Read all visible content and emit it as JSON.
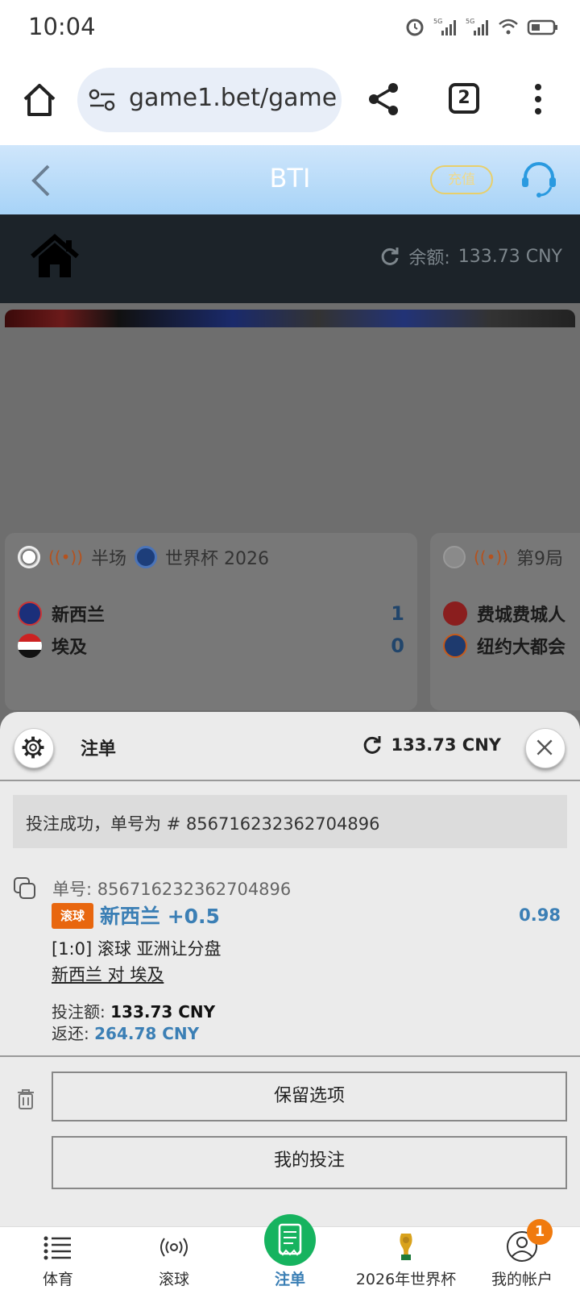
{
  "status_bar": {
    "time": "10:04"
  },
  "browser": {
    "url": "game1.bet/game",
    "tab_count": "2"
  },
  "site_header": {
    "title": "BTI",
    "deposit_label": "充值"
  },
  "balance_bar": {
    "label": "余额:",
    "amount": "133.73 CNY"
  },
  "match_cards": [
    {
      "period": "半场",
      "competition": "世界杯 2026",
      "home_team": "新西兰",
      "away_team": "埃及",
      "home_score": "1",
      "away_score": "0"
    },
    {
      "period": "第9局",
      "home_team": "费城费城人",
      "away_team": "纽约大都会"
    }
  ],
  "bet_slip": {
    "title": "注单",
    "balance": "133.73 CNY",
    "success_message": "投注成功，单号为 # 856716232362704896",
    "ticket_label": "单号:",
    "ticket_number": "856716232362704896",
    "live_badge": "滚球",
    "selection": "新西兰 +0.5",
    "odds": "0.98",
    "market": "[1:0] 滚球 亚洲让分盘",
    "fixture": "新西兰 对 埃及",
    "stake_label": "投注额:",
    "stake": "133.73 CNY",
    "return_label": "返还:",
    "return": "264.78 CNY",
    "keep_selection_label": "保留选项",
    "my_bets_label": "我的投注"
  },
  "bottom_nav": {
    "items": [
      {
        "label": "体育",
        "icon": "list-icon"
      },
      {
        "label": "滚球",
        "icon": "live-broadcast-icon"
      },
      {
        "label": "注单",
        "icon": "receipt-icon"
      },
      {
        "label": "2026年世界杯",
        "icon": "trophy-icon"
      },
      {
        "label": "我的帐户",
        "icon": "user-icon"
      }
    ],
    "account_badge": "1"
  },
  "colors": {
    "accent_blue": "#3b7fb5",
    "live_orange": "#e8660e",
    "slip_green": "#16b35f",
    "header_dark": "#1c2329"
  }
}
